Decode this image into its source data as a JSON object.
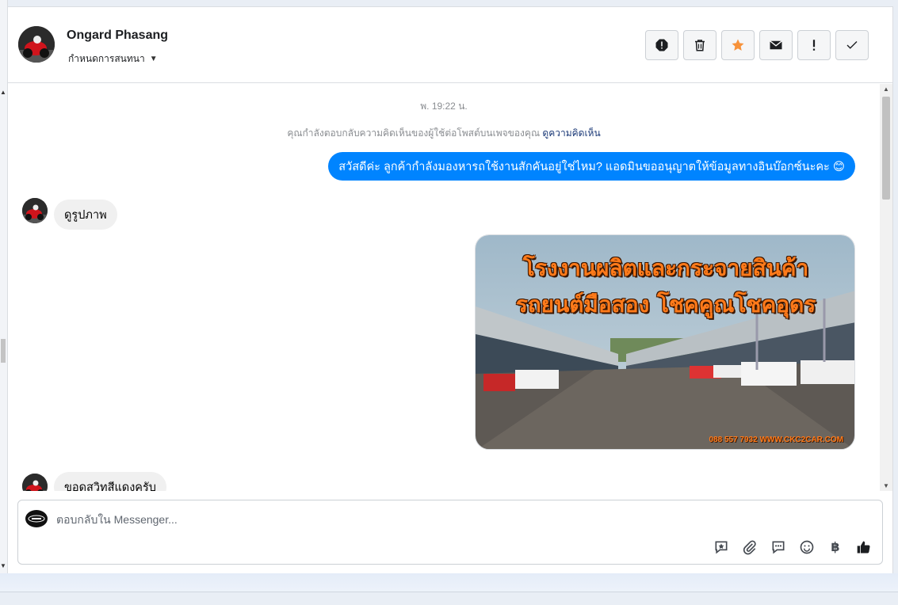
{
  "header": {
    "name": "Ongard Phasang",
    "assign_label": "กำหนดการสนทนา"
  },
  "actions": [
    {
      "name": "report-icon"
    },
    {
      "name": "trash-icon"
    },
    {
      "name": "star-icon",
      "color": "#f7923a"
    },
    {
      "name": "envelope-icon"
    },
    {
      "name": "exclamation-icon"
    },
    {
      "name": "check-icon"
    }
  ],
  "chat": {
    "timestamp": "พ. 19:22 น.",
    "reply_note": "คุณกำลังตอบกลับความคิดเห็นของผู้ใช้ต่อโพสต์บนเพจของคุณ",
    "reply_note_link": "ดูความคิดเห็น",
    "outgoing_message": "สวัสดีค่ะ ลูกค้ากำลังมองหารถใช้งานสักคันอยู่ใช่ไหม? แอดมินขออนุญาตให้ข้อมูลทางอินบ๊อกซ์นะคะ 😊",
    "incoming_1": "ดูรูปภาพ",
    "image": {
      "line1": "โรงงานผลิตและกระจายสินค้า",
      "line2": "รถยนต์มือสอง โชคคูณโชคอุดร",
      "footer": "088 557 7932 WWW.CKC2CAR.COM"
    },
    "incoming_2": "ขอดูสวิทสีแดงครับ"
  },
  "composer": {
    "placeholder": "ตอบกลับใน Messenger...",
    "tools": [
      "saved-reply-icon",
      "attachment-icon",
      "quick-reply-icon",
      "emoji-icon",
      "baht-icon",
      "thumbs-up-icon"
    ],
    "baht_symbol": "฿"
  },
  "colors": {
    "accent": "#0084ff",
    "star": "#f7923a"
  }
}
